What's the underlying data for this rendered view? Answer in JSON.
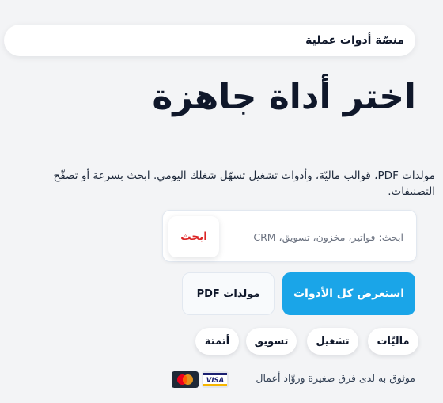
{
  "header": {
    "brand": "منصّة أدوات عملية"
  },
  "hero": {
    "title": "اختر أداة جاهزة",
    "description": "مولدات PDF، قوالب ماليّة، وأدوات تشغيل تسهّل شغلك اليومي. ابحث بسرعة أو تصفّح التصنيفات."
  },
  "search": {
    "placeholder": "ابحث: فواتير، مخزون، تسويق، CRM",
    "value": "",
    "button_label": "ابحث"
  },
  "actions": {
    "browse_all": "استعرض كل الأدوات",
    "pdf_generators": "مولدات PDF"
  },
  "categories": [
    "ماليّات",
    "تشغيل",
    "تسويق",
    "أتمتة"
  ],
  "trust": {
    "text": "موثوق به لدى فرق صغيرة وروّاد أعمال",
    "payment_icons": [
      "visa-icon",
      "mastercard-icon"
    ]
  },
  "colors": {
    "primary": "#1aa5e8",
    "search_button_text": "#dc2626",
    "background": "#f3f4f6",
    "text": "#0f172a"
  }
}
